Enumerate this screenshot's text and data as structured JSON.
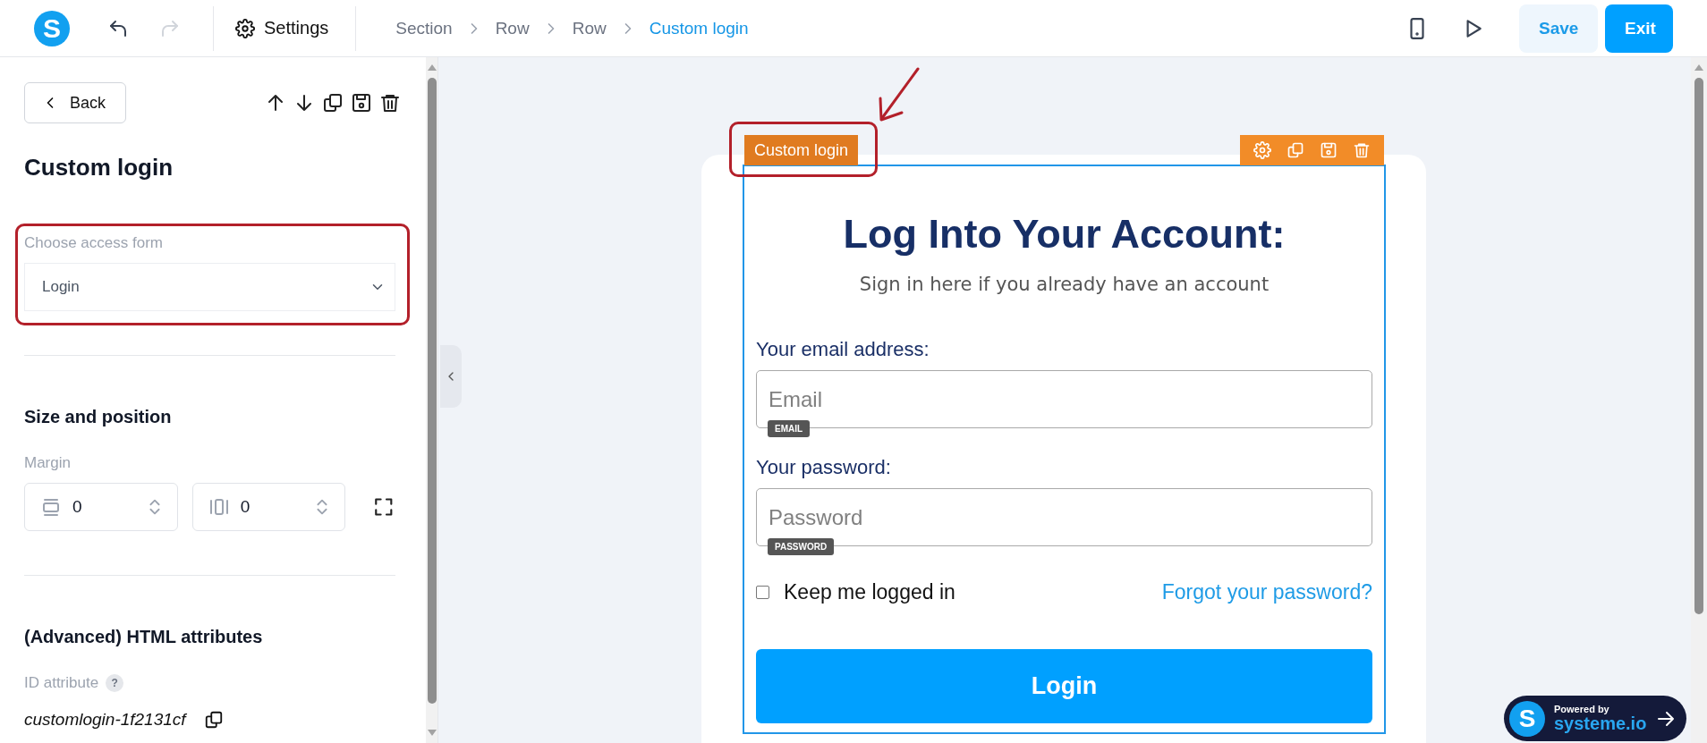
{
  "toolbar": {
    "logo": "S",
    "history": [
      {
        "kind": "undo",
        "disabled": false
      },
      {
        "kind": "redo",
        "disabled": true
      }
    ],
    "settings_label": "Settings",
    "breadcrumbs": [
      {
        "label": "Section",
        "current": false
      },
      {
        "label": "Row",
        "current": false
      },
      {
        "label": "Row",
        "current": false
      },
      {
        "label": "Custom login",
        "current": true
      }
    ],
    "buttons": [
      {
        "label": "Save",
        "kind": "secondary"
      },
      {
        "label": "Exit",
        "kind": "primary"
      }
    ]
  },
  "sidebar": {
    "back_label": "Back",
    "title": "Custom login",
    "access_form": {
      "label": "Choose access form",
      "value": "Login"
    },
    "size_heading": "Size and position",
    "margin": {
      "label": "Margin",
      "fields": [
        {
          "kind": "vertical",
          "value": "0"
        },
        {
          "kind": "horizontal",
          "value": "0"
        }
      ]
    },
    "advanced_heading": "(Advanced) HTML attributes",
    "id_attribute": {
      "label": "ID attribute",
      "help": "?",
      "value": "customlogin-1f2131cf"
    }
  },
  "canvas": {
    "element_tag": "Custom login",
    "form": {
      "title": "Log Into Your Account:",
      "subtitle": "Sign in here if you already have an account",
      "fields": [
        {
          "label": "Your email address:",
          "placeholder": "Email",
          "badge": "EMAIL"
        },
        {
          "label": "Your password:",
          "placeholder": "Password",
          "badge": "PASSWORD"
        }
      ],
      "remember": {
        "label": "Keep me logged in",
        "checked": false
      },
      "forgot_link": "Forgot your password?",
      "submit": "Login"
    }
  },
  "powered_badge": {
    "logo": "S",
    "caption": "Powered by",
    "brand": "systeme.io"
  }
}
